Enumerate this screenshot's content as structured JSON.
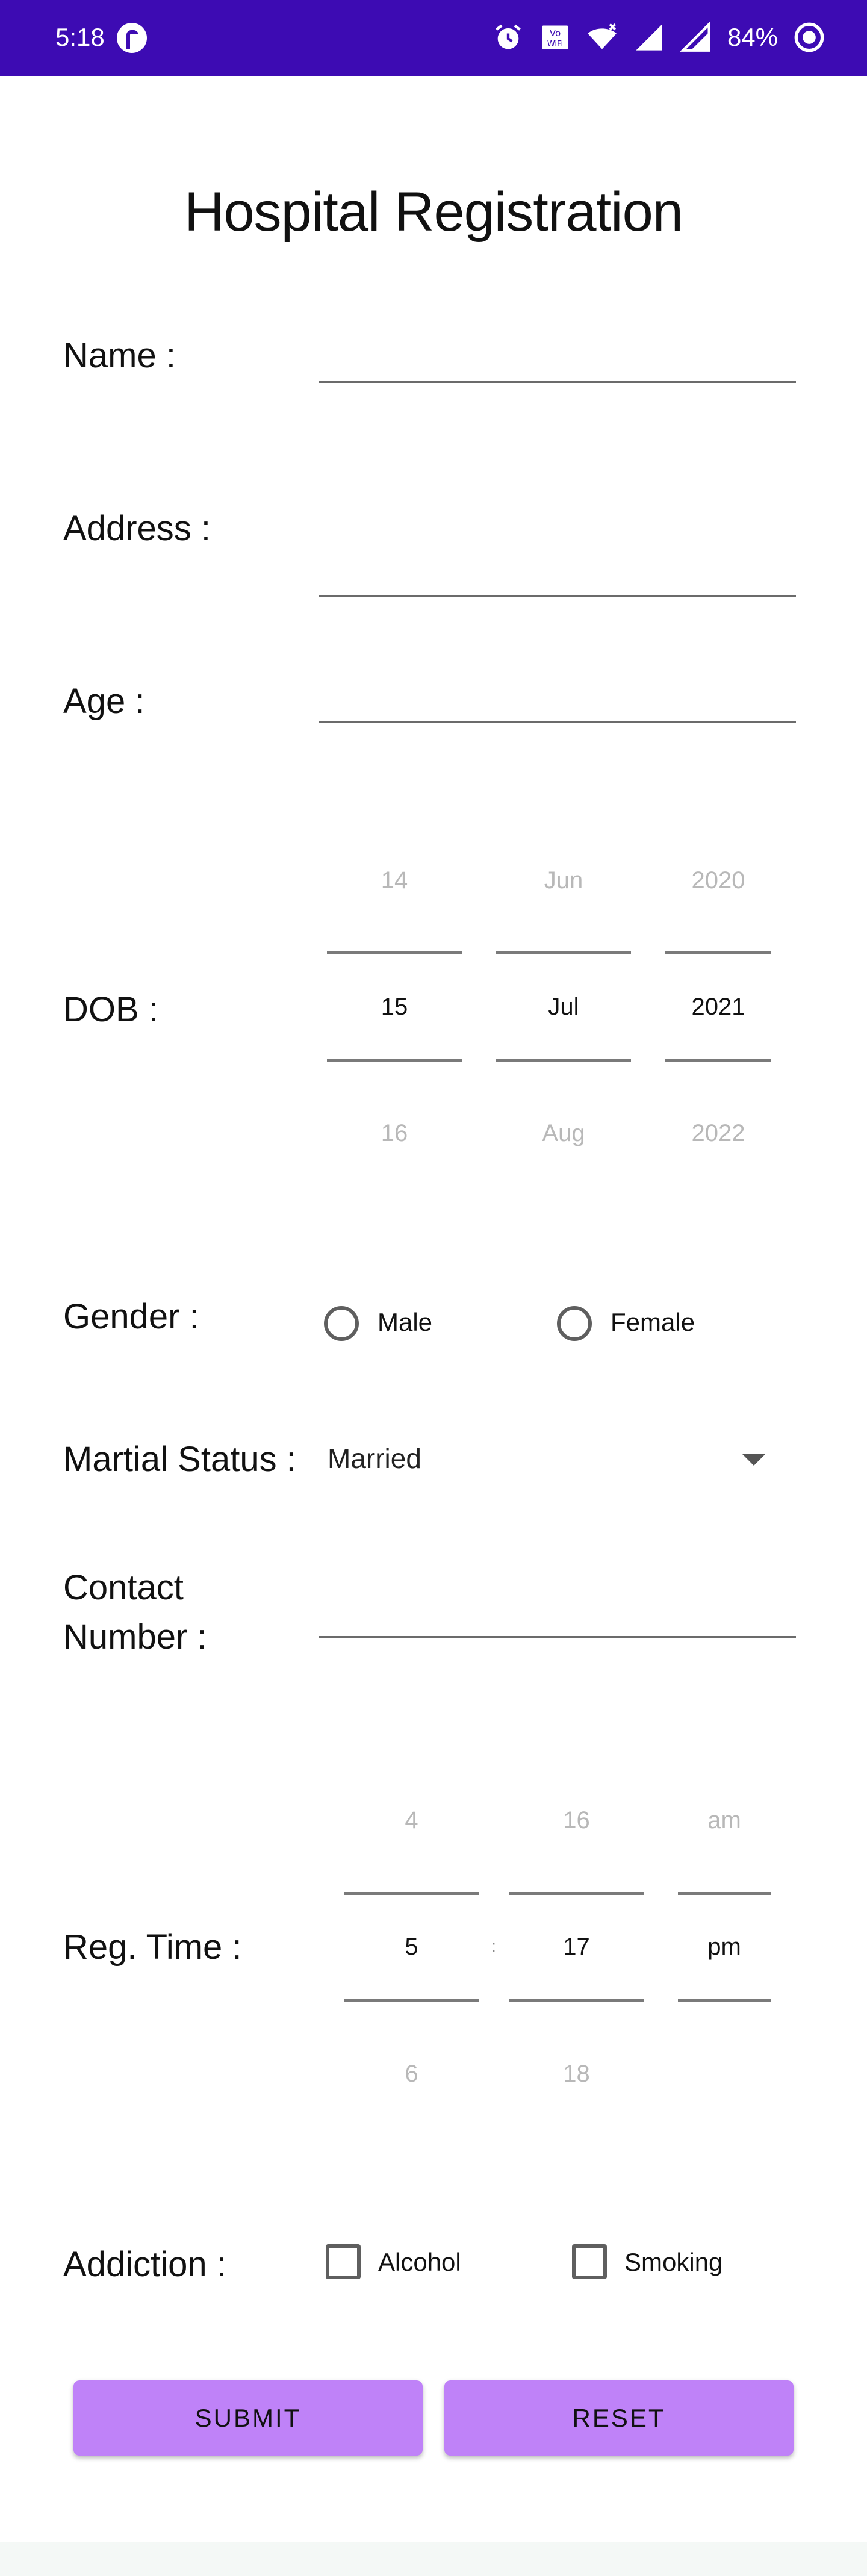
{
  "status_bar": {
    "time": "5:18",
    "battery": "84%",
    "icons": [
      "app-icon",
      "alarm-icon",
      "vowifi-icon",
      "wifi-icon",
      "signal-icon",
      "signal-icon-2",
      "battery-saver-icon"
    ],
    "vowifi_label": "VoWiFi"
  },
  "title": "Hospital Registration",
  "form": {
    "name_label": "Name :",
    "address_label": "Address :",
    "age_label": "Age :",
    "dob_label": "DOB :",
    "dob": {
      "day": {
        "prev": "14",
        "value": "15",
        "next": "16"
      },
      "month": {
        "prev": "Jun",
        "value": "Jul",
        "next": "Aug"
      },
      "year": {
        "prev": "2020",
        "value": "2021",
        "next": "2022"
      }
    },
    "gender_label": "Gender :",
    "gender_options": [
      "Male",
      "Female"
    ],
    "marital_label": "Martial Status :",
    "marital_value": "Married",
    "contact_label_line1": "Contact",
    "contact_label_line2": "Number :",
    "reg_time_label": "Reg. Time :",
    "reg_time": {
      "hour": {
        "prev": "4",
        "value": "5",
        "next": "6"
      },
      "separator": ":",
      "minute": {
        "prev": "16",
        "value": "17",
        "next": "18"
      },
      "ampm": {
        "prev": "am",
        "value": "pm"
      }
    },
    "addiction_label": "Addiction :",
    "addiction_options": [
      "Alcohol",
      "Smoking"
    ],
    "submit_label": "SUBMIT",
    "reset_label": "RESET"
  },
  "colors": {
    "status_bar": "#3d0bb3",
    "button": "#bf82f8"
  }
}
